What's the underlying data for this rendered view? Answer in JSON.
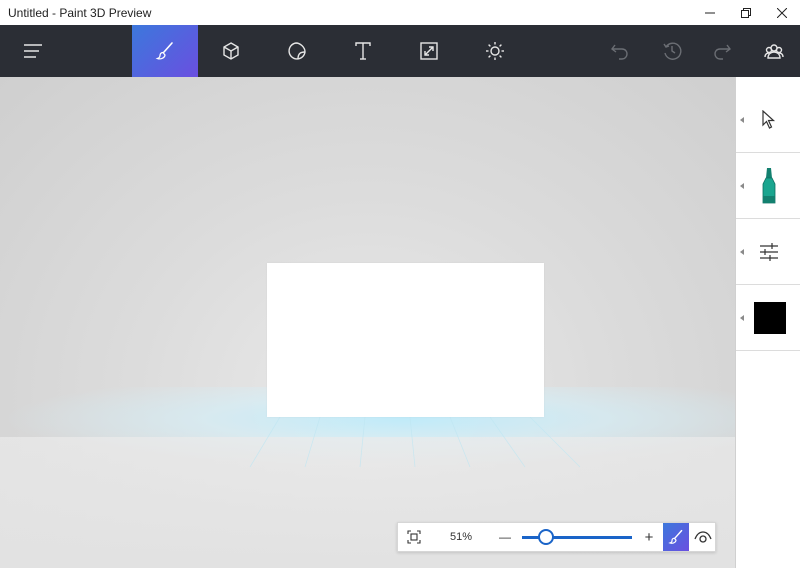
{
  "window": {
    "title": "Untitled - Paint 3D Preview",
    "minimize_icon": "minimize-icon",
    "maximize_icon": "restore-icon",
    "close_icon": "close-icon"
  },
  "toolbar": {
    "menu_icon": "hamburger-menu-icon",
    "tools": [
      {
        "name": "brushes",
        "icon": "brush-icon",
        "active": true
      },
      {
        "name": "3d-objects",
        "icon": "cube-icon",
        "active": false
      },
      {
        "name": "stickers",
        "icon": "sticker-icon",
        "active": false
      },
      {
        "name": "text",
        "icon": "text-icon",
        "active": false
      },
      {
        "name": "canvas",
        "icon": "resize-icon",
        "active": false
      },
      {
        "name": "effects",
        "icon": "sun-icon",
        "active": false
      }
    ],
    "actions": [
      {
        "name": "undo",
        "icon": "undo-icon"
      },
      {
        "name": "history",
        "icon": "history-icon"
      },
      {
        "name": "redo",
        "icon": "redo-icon"
      },
      {
        "name": "community",
        "icon": "remix-community-icon"
      }
    ],
    "accent_color": "#3c78dc",
    "background_color": "#2b2e35"
  },
  "side_panel": {
    "items": [
      {
        "name": "select",
        "icon": "cursor-arrow-icon"
      },
      {
        "name": "marker",
        "icon": "marker-icon",
        "color": "#1aa58f"
      },
      {
        "name": "thickness-opacity",
        "icon": "sliders-icon"
      },
      {
        "name": "color",
        "icon": "color-swatch-icon",
        "color": "#000000"
      }
    ]
  },
  "zoom": {
    "percent_label": "51%",
    "value_fraction": 0.22,
    "fit_icon": "fit-to-screen-icon",
    "minus_label": "—",
    "plus_label": "+",
    "brush_icon": "brush-icon",
    "view_icon": "eye-icon"
  }
}
